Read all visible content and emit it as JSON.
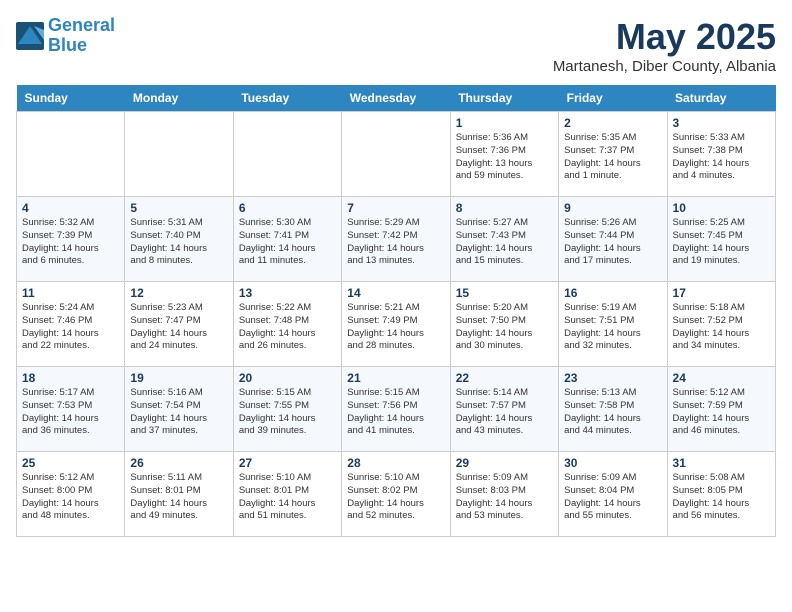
{
  "header": {
    "logo_line1": "General",
    "logo_line2": "Blue",
    "month_year": "May 2025",
    "location": "Martanesh, Diber County, Albania"
  },
  "weekdays": [
    "Sunday",
    "Monday",
    "Tuesday",
    "Wednesday",
    "Thursday",
    "Friday",
    "Saturday"
  ],
  "weeks": [
    [
      {
        "day": "",
        "info": ""
      },
      {
        "day": "",
        "info": ""
      },
      {
        "day": "",
        "info": ""
      },
      {
        "day": "",
        "info": ""
      },
      {
        "day": "1",
        "info": "Sunrise: 5:36 AM\nSunset: 7:36 PM\nDaylight: 13 hours\nand 59 minutes."
      },
      {
        "day": "2",
        "info": "Sunrise: 5:35 AM\nSunset: 7:37 PM\nDaylight: 14 hours\nand 1 minute."
      },
      {
        "day": "3",
        "info": "Sunrise: 5:33 AM\nSunset: 7:38 PM\nDaylight: 14 hours\nand 4 minutes."
      }
    ],
    [
      {
        "day": "4",
        "info": "Sunrise: 5:32 AM\nSunset: 7:39 PM\nDaylight: 14 hours\nand 6 minutes."
      },
      {
        "day": "5",
        "info": "Sunrise: 5:31 AM\nSunset: 7:40 PM\nDaylight: 14 hours\nand 8 minutes."
      },
      {
        "day": "6",
        "info": "Sunrise: 5:30 AM\nSunset: 7:41 PM\nDaylight: 14 hours\nand 11 minutes."
      },
      {
        "day": "7",
        "info": "Sunrise: 5:29 AM\nSunset: 7:42 PM\nDaylight: 14 hours\nand 13 minutes."
      },
      {
        "day": "8",
        "info": "Sunrise: 5:27 AM\nSunset: 7:43 PM\nDaylight: 14 hours\nand 15 minutes."
      },
      {
        "day": "9",
        "info": "Sunrise: 5:26 AM\nSunset: 7:44 PM\nDaylight: 14 hours\nand 17 minutes."
      },
      {
        "day": "10",
        "info": "Sunrise: 5:25 AM\nSunset: 7:45 PM\nDaylight: 14 hours\nand 19 minutes."
      }
    ],
    [
      {
        "day": "11",
        "info": "Sunrise: 5:24 AM\nSunset: 7:46 PM\nDaylight: 14 hours\nand 22 minutes."
      },
      {
        "day": "12",
        "info": "Sunrise: 5:23 AM\nSunset: 7:47 PM\nDaylight: 14 hours\nand 24 minutes."
      },
      {
        "day": "13",
        "info": "Sunrise: 5:22 AM\nSunset: 7:48 PM\nDaylight: 14 hours\nand 26 minutes."
      },
      {
        "day": "14",
        "info": "Sunrise: 5:21 AM\nSunset: 7:49 PM\nDaylight: 14 hours\nand 28 minutes."
      },
      {
        "day": "15",
        "info": "Sunrise: 5:20 AM\nSunset: 7:50 PM\nDaylight: 14 hours\nand 30 minutes."
      },
      {
        "day": "16",
        "info": "Sunrise: 5:19 AM\nSunset: 7:51 PM\nDaylight: 14 hours\nand 32 minutes."
      },
      {
        "day": "17",
        "info": "Sunrise: 5:18 AM\nSunset: 7:52 PM\nDaylight: 14 hours\nand 34 minutes."
      }
    ],
    [
      {
        "day": "18",
        "info": "Sunrise: 5:17 AM\nSunset: 7:53 PM\nDaylight: 14 hours\nand 36 minutes."
      },
      {
        "day": "19",
        "info": "Sunrise: 5:16 AM\nSunset: 7:54 PM\nDaylight: 14 hours\nand 37 minutes."
      },
      {
        "day": "20",
        "info": "Sunrise: 5:15 AM\nSunset: 7:55 PM\nDaylight: 14 hours\nand 39 minutes."
      },
      {
        "day": "21",
        "info": "Sunrise: 5:15 AM\nSunset: 7:56 PM\nDaylight: 14 hours\nand 41 minutes."
      },
      {
        "day": "22",
        "info": "Sunrise: 5:14 AM\nSunset: 7:57 PM\nDaylight: 14 hours\nand 43 minutes."
      },
      {
        "day": "23",
        "info": "Sunrise: 5:13 AM\nSunset: 7:58 PM\nDaylight: 14 hours\nand 44 minutes."
      },
      {
        "day": "24",
        "info": "Sunrise: 5:12 AM\nSunset: 7:59 PM\nDaylight: 14 hours\nand 46 minutes."
      }
    ],
    [
      {
        "day": "25",
        "info": "Sunrise: 5:12 AM\nSunset: 8:00 PM\nDaylight: 14 hours\nand 48 minutes."
      },
      {
        "day": "26",
        "info": "Sunrise: 5:11 AM\nSunset: 8:01 PM\nDaylight: 14 hours\nand 49 minutes."
      },
      {
        "day": "27",
        "info": "Sunrise: 5:10 AM\nSunset: 8:01 PM\nDaylight: 14 hours\nand 51 minutes."
      },
      {
        "day": "28",
        "info": "Sunrise: 5:10 AM\nSunset: 8:02 PM\nDaylight: 14 hours\nand 52 minutes."
      },
      {
        "day": "29",
        "info": "Sunrise: 5:09 AM\nSunset: 8:03 PM\nDaylight: 14 hours\nand 53 minutes."
      },
      {
        "day": "30",
        "info": "Sunrise: 5:09 AM\nSunset: 8:04 PM\nDaylight: 14 hours\nand 55 minutes."
      },
      {
        "day": "31",
        "info": "Sunrise: 5:08 AM\nSunset: 8:05 PM\nDaylight: 14 hours\nand 56 minutes."
      }
    ]
  ]
}
